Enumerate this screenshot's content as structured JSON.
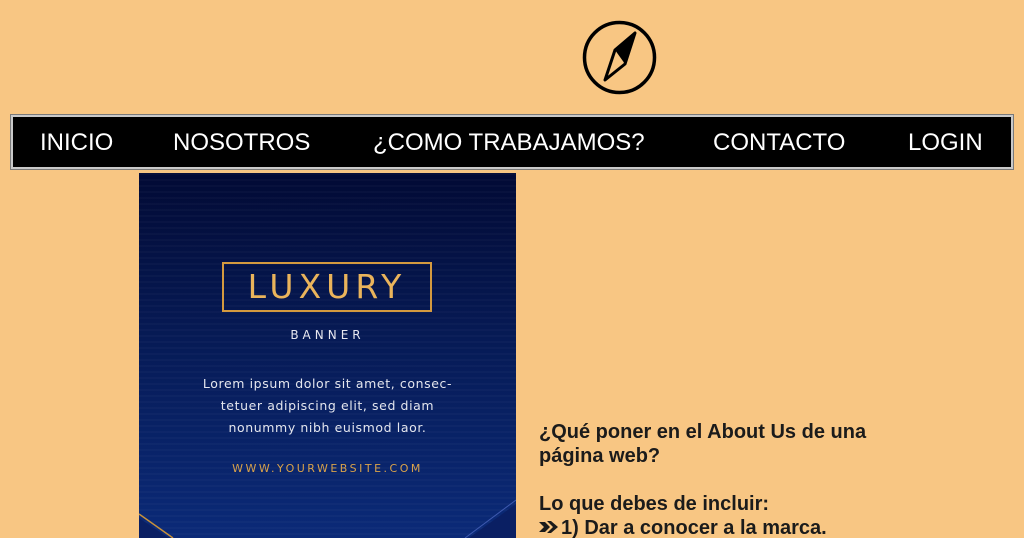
{
  "header": {
    "logo_icon": "compass-icon"
  },
  "nav": {
    "items": [
      {
        "label": "INICIO"
      },
      {
        "label": "NOSOTROS"
      },
      {
        "label": "¿COMO TRABAJAMOS?"
      },
      {
        "label": "CONTACTO"
      },
      {
        "label": "LOGIN"
      }
    ]
  },
  "banner": {
    "title": "LUXURY",
    "subtitle": "BANNER",
    "body_line1": "Lorem ipsum dolor sit amet, consec-",
    "body_line2": "tetuer adipiscing elit, sed diam",
    "body_line3": "nonummy nibh euismod laor.",
    "url": "WWW.YOURWEBSITE.COM"
  },
  "content": {
    "question": "¿Qué poner en el About Us de una página web?",
    "heading": "Lo que debes de incluir:",
    "list": [
      {
        "bullet_icon": "double-arrow-icon",
        "text": "1) Dar a conocer a la marca."
      }
    ]
  },
  "colors": {
    "background": "#f8c683",
    "navbar": "#000000",
    "banner_gold": "#d49a3f",
    "banner_navy": "#061a55"
  }
}
